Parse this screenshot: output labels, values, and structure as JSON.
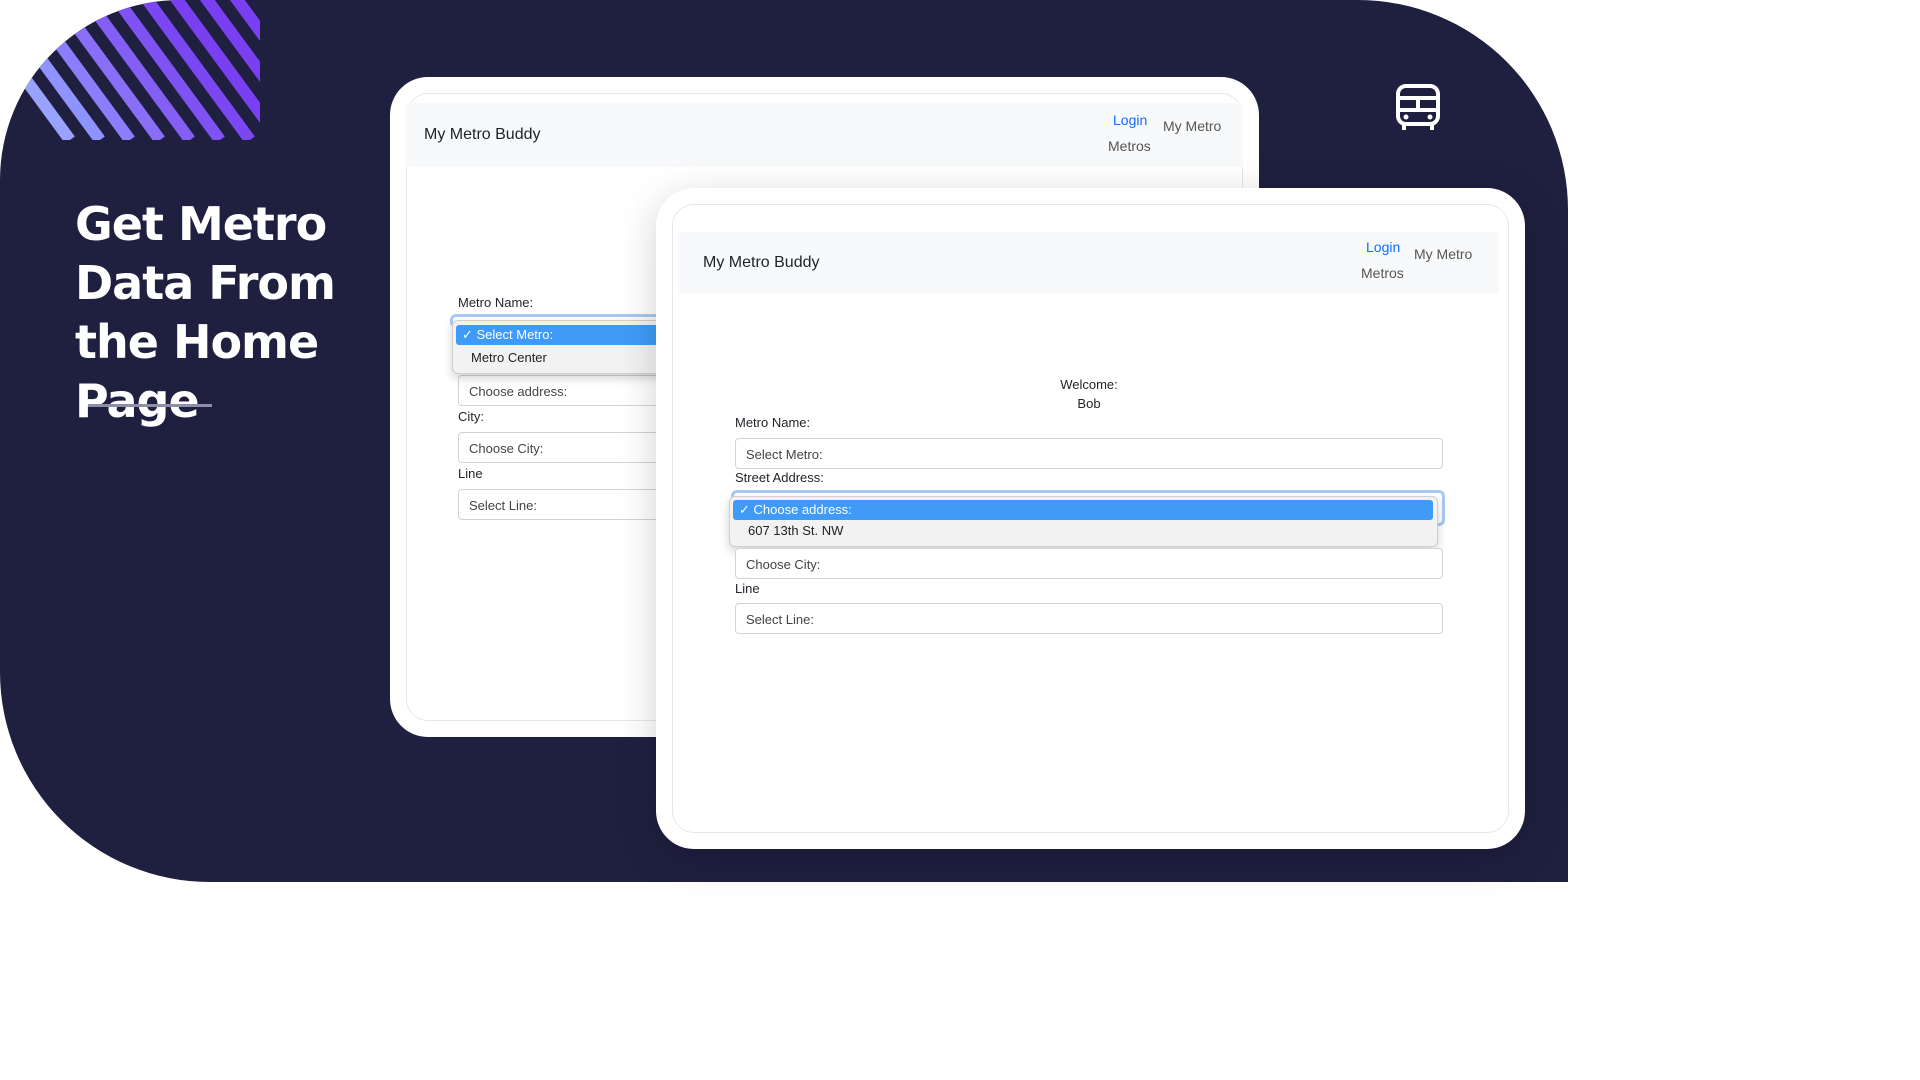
{
  "headline": "Get Metro Data From the Home Page",
  "decor": {
    "bus_icon": "bus-front-icon",
    "stripes": "diagonal-stripes-decoration"
  },
  "colors": {
    "background": "#1f1f40",
    "accent_purple": "#7b3ff2",
    "link": "#0d6efd",
    "select_highlight": "#3f9bf7"
  },
  "back_screen": {
    "brand": "My Metro Buddy",
    "nav": {
      "login": "Login",
      "my_metro": "My Metro",
      "metros": "Metros"
    },
    "metro_name_label": "Metro Name:",
    "metro_dropdown": {
      "selected": "✓ Select Metro:",
      "options": [
        "Metro Center"
      ]
    },
    "address_select": "Choose address:",
    "city_label": "City:",
    "city_select": "Choose City:",
    "line_label": "Line",
    "line_select": "Select Line:"
  },
  "front_screen": {
    "brand": "My Metro Buddy",
    "nav": {
      "login": "Login",
      "my_metro": "My Metro",
      "metros": "Metros"
    },
    "welcome_label": "Welcome:",
    "welcome_user": "Bob",
    "metro_name_label": "Metro Name:",
    "metro_select": "Select Metro:",
    "street_address_label": "Street Address:",
    "address_dropdown": {
      "selected": "✓ Choose address:",
      "options": [
        "607 13th St. NW"
      ]
    },
    "city_select": "Choose City:",
    "line_label": "Line",
    "line_select": "Select Line:"
  }
}
